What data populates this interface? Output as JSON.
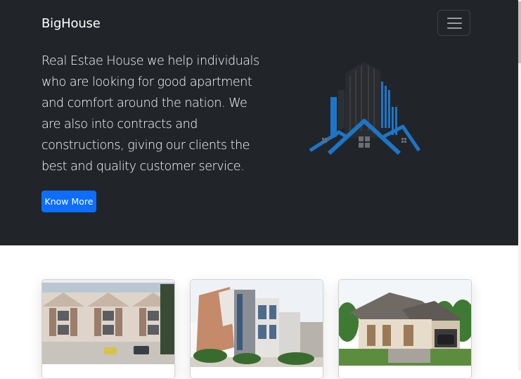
{
  "navbar": {
    "brand": "BigHouse",
    "toggler_icon": "hamburger-menu-icon"
  },
  "hero": {
    "text": "Real Estae House we help individuals who are looking for good apartment and comfort around the nation. We are also into contracts and constructions, giving our clients the best and quality customer service.",
    "button_label": "Know More",
    "logo_icon": "building-house-logo-icon"
  },
  "colors": {
    "hero_background": "#212529",
    "button": "#0d6efd",
    "logo_blue": "#1d75c7",
    "logo_dark": "#2d2f33"
  },
  "cards": [
    {
      "image": "modern-townhouses-photo"
    },
    {
      "image": "modern-villa-photo"
    },
    {
      "image": "bungalow-house-photo"
    }
  ]
}
